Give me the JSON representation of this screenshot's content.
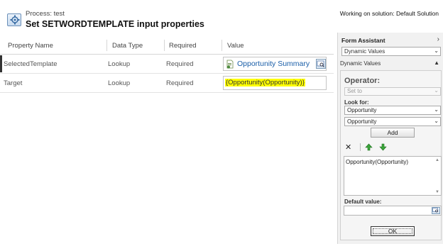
{
  "header": {
    "process_label": "Process: test",
    "title": "Set SETWORDTEMPLATE input properties",
    "solution": "Working on solution: Default Solution",
    "icon": "process-gear-icon"
  },
  "grid": {
    "columns": [
      "Property Name",
      "Data Type",
      "Required",
      "Value"
    ],
    "rows": [
      {
        "property": "SelectedTemplate",
        "type": "Lookup",
        "required": "Required",
        "value": "Opportunity Summary",
        "value_icon": "document-template-icon"
      },
      {
        "property": "Target",
        "type": "Lookup",
        "required": "Required",
        "value": "{Opportunity(Opportunity)}"
      }
    ]
  },
  "form_assistant": {
    "title": "Form Assistant",
    "collapse_icon": "chevron-right-icon",
    "mode_select": "Dynamic Values",
    "section_label": "Dynamic Values",
    "section_icon": "triangle-up-icon",
    "operator_label": "Operator:",
    "operator_value": "Set to",
    "look_for_label": "Look for:",
    "look_for_entity": "Opportunity",
    "look_for_field": "Opportunity",
    "add_label": "Add",
    "list_items": [
      "Opportunity(Opportunity)"
    ],
    "default_value_label": "Default value:",
    "default_value": "",
    "ok_label": "OK",
    "highlight_color": "#ffff00",
    "link_color": "#1a5ea8"
  }
}
